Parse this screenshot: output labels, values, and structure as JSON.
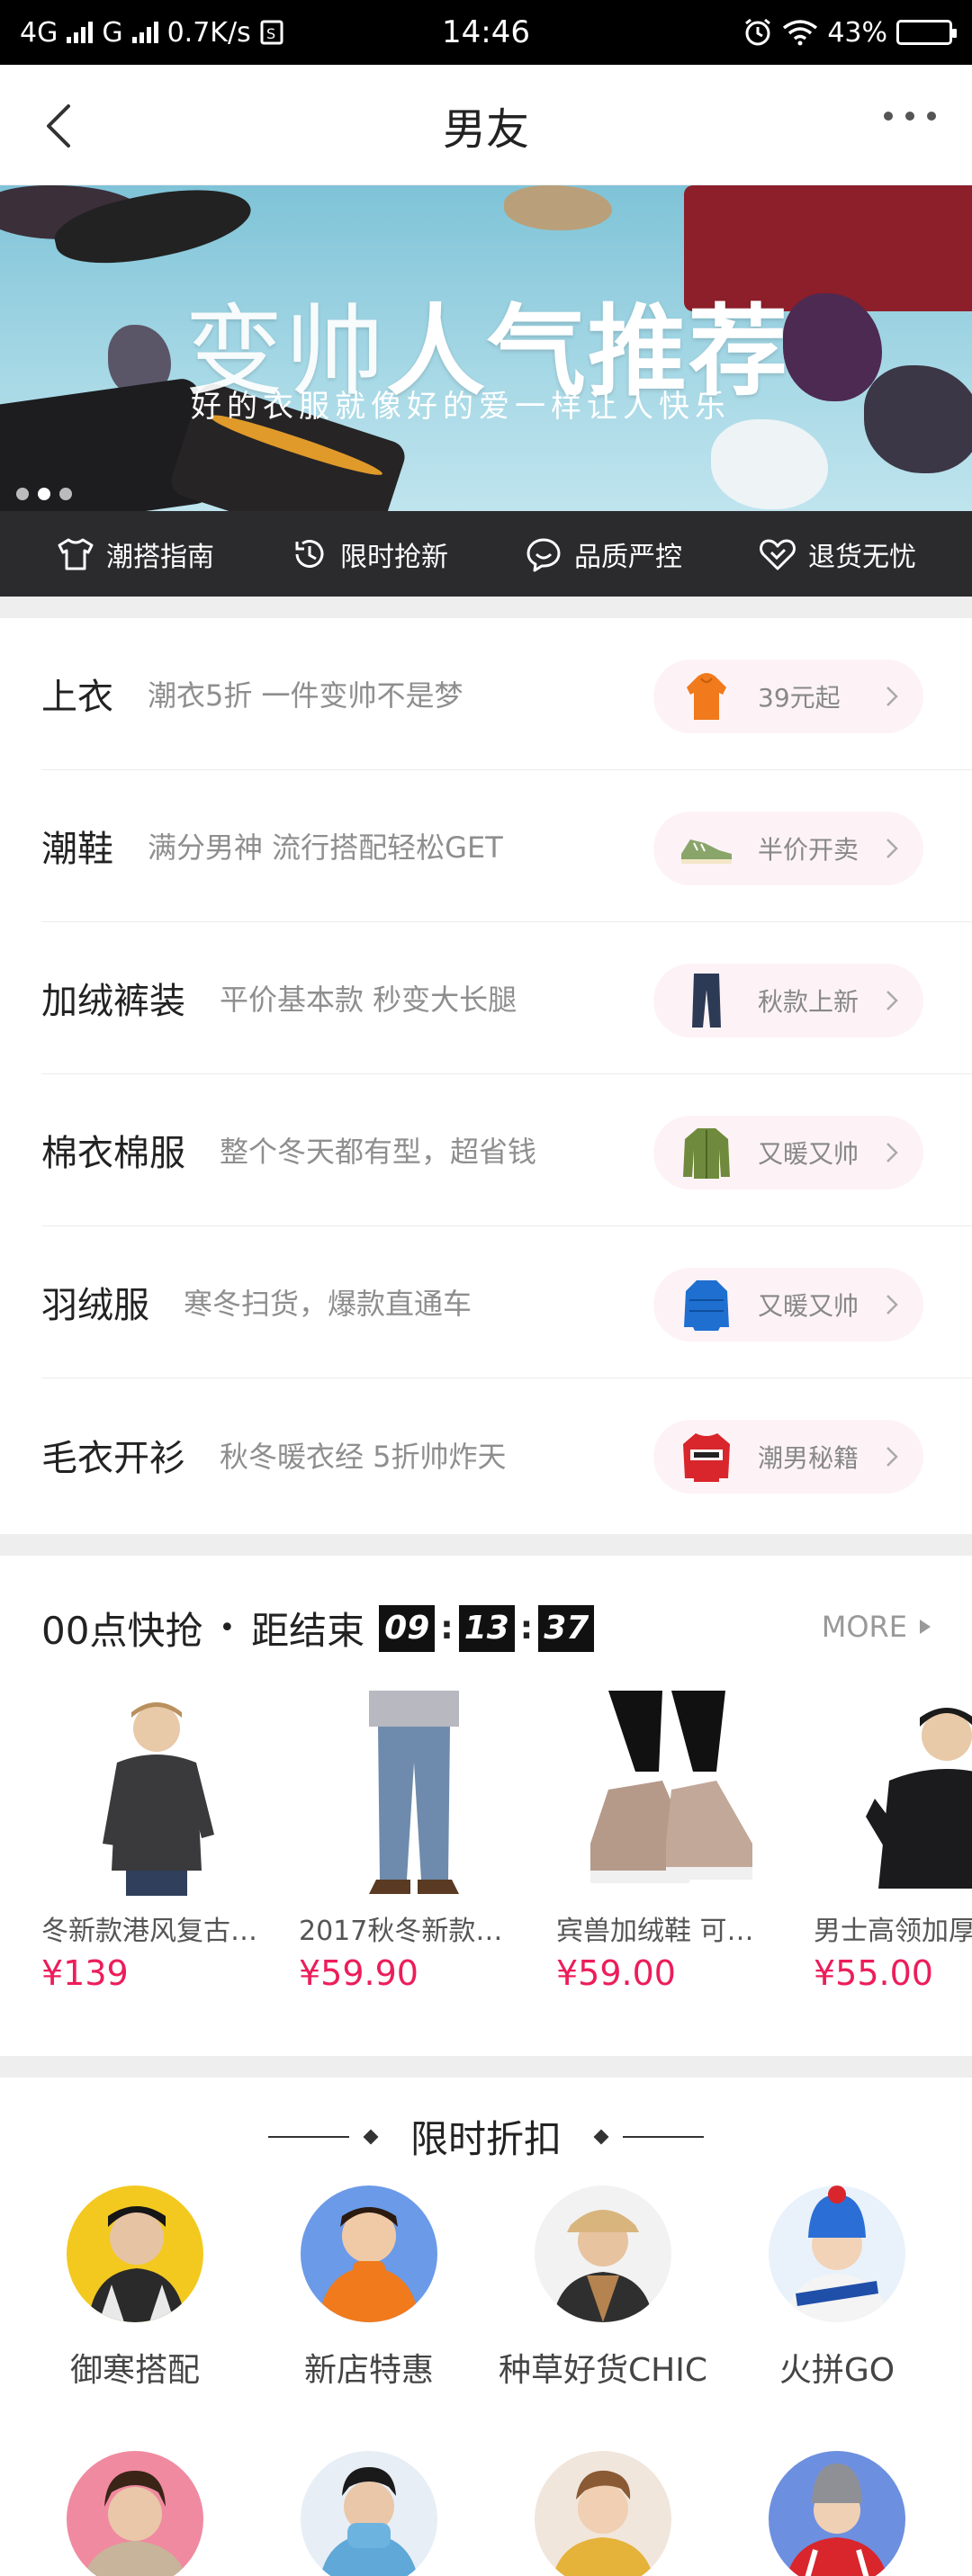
{
  "status_bar": {
    "network_left": "4G",
    "network_right": "G",
    "speed": "0.7K/s",
    "time": "14:46",
    "battery": "43%",
    "battery_level": 0.43
  },
  "nav": {
    "title": "男友"
  },
  "banner": {
    "title_part1": "变帅",
    "title_part2": "人气推荐",
    "subtitle": "好的衣服就像好的爱一样让人快乐"
  },
  "services": [
    {
      "label": "潮搭指南",
      "icon": "tshirt-icon"
    },
    {
      "label": "限时抢新",
      "icon": "clock-icon"
    },
    {
      "label": "品质严控",
      "icon": "chat-bubble-icon"
    },
    {
      "label": "退货无忧",
      "icon": "heart-icon"
    }
  ],
  "categories": [
    {
      "name": "上衣",
      "desc": "潮衣5折 一件变帅不是梦",
      "tag": "39元起",
      "thumb": "hoodie-icon",
      "color": "#f07a1c"
    },
    {
      "name": "潮鞋",
      "desc": "满分男神 流行搭配轻松GET",
      "tag": "半价开卖",
      "thumb": "sneaker-icon",
      "color": "#7a9a5a"
    },
    {
      "name": "加绒裤装",
      "desc": "平价基本款 秒变大长腿",
      "tag": "秋款上新",
      "thumb": "jeans-icon",
      "color": "#2d3a55"
    },
    {
      "name": "棉衣棉服",
      "desc": "整个冬天都有型，超省钱",
      "tag": "又暖又帅",
      "thumb": "jacket-icon",
      "color": "#6f8a3c"
    },
    {
      "name": "羽绒服",
      "desc": "寒冬扫货，爆款直通车",
      "tag": "又暖又帅",
      "thumb": "down-jacket-icon",
      "color": "#1f6fd1"
    },
    {
      "name": "毛衣开衫",
      "desc": "秋冬暖衣经 5折帅炸天",
      "tag": "潮男秘籍",
      "thumb": "sweater-icon",
      "color": "#d8262c"
    }
  ],
  "flash_sale": {
    "title": "00点快抢",
    "dot": "•",
    "countdown_label": "距结束",
    "hours": "09",
    "minutes": "13",
    "seconds": "37",
    "more": "MORE",
    "products": [
      {
        "name": "冬新款港风复古…",
        "price": "¥139"
      },
      {
        "name": "2017秋冬新款…",
        "price": "¥59.90"
      },
      {
        "name": "宾兽加绒鞋 可…",
        "price": "¥59.00"
      },
      {
        "name": "男士高领加厚",
        "price": "¥55.00"
      }
    ]
  },
  "discount": {
    "title": "限时折扣",
    "items": [
      {
        "label": "御寒搭配",
        "bg": "#f3c91f"
      },
      {
        "label": "新店特惠",
        "bg": "#6b9ae8"
      },
      {
        "label": "种草好货CHIC",
        "bg": "#f2f2f2"
      },
      {
        "label": "火拼GO",
        "bg": "#e9f2fb"
      }
    ],
    "row2": [
      {
        "bg": "#f08aa0"
      },
      {
        "bg": "#e8eef5"
      },
      {
        "bg": "#f1e6dc"
      },
      {
        "bg": "#6d8fe0"
      }
    ]
  }
}
